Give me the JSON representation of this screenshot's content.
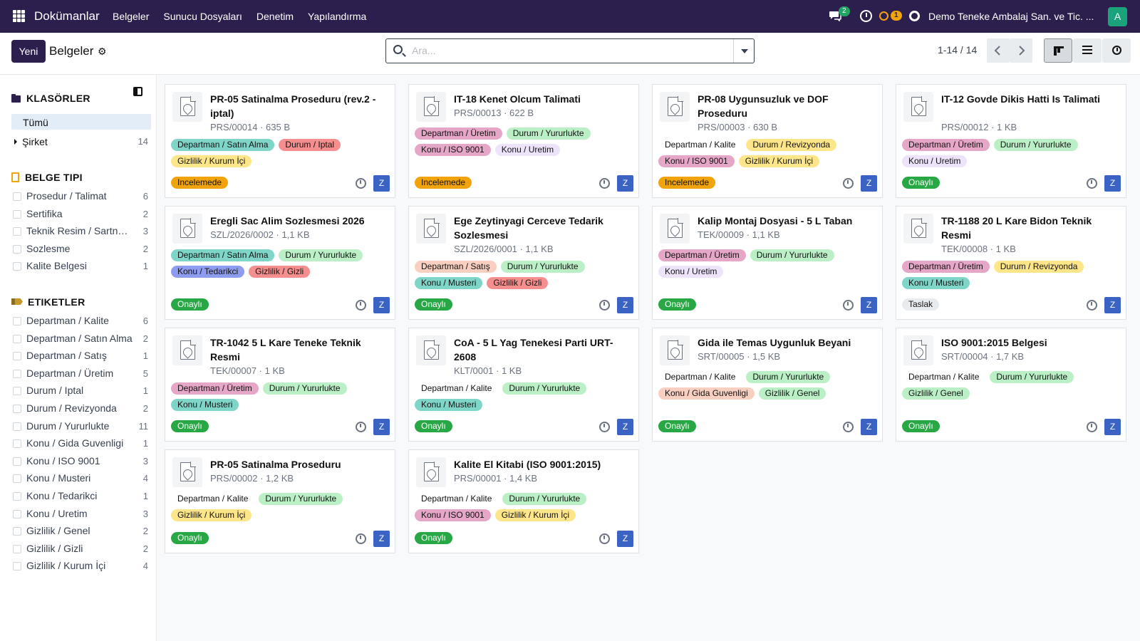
{
  "topbar": {
    "app_name": "Dokümanlar",
    "menu": [
      "Belgeler",
      "Sunucu Dosyaları",
      "Denetim",
      "Yapılandırma"
    ],
    "chat_count": "2",
    "activity_count": "1",
    "company": "Demo Teneke Ambalaj San. ve Tic. ...",
    "avatar_letter": "A",
    "bg_color": "#2c1f4e"
  },
  "control": {
    "new_label": "Yeni",
    "breadcrumb": "Belgeler",
    "search_placeholder": "Ara...",
    "pager": "1-14 / 14"
  },
  "sidebar": {
    "folders_title": "KLASÖRLER",
    "all_label": "Tümü",
    "company_folder": {
      "label": "Şirket",
      "count": "14"
    },
    "doctype_title": "BELGE TIPI",
    "doctypes": [
      {
        "label": "Prosedur / Talimat",
        "count": "6"
      },
      {
        "label": "Sertifika",
        "count": "2"
      },
      {
        "label": "Teknik Resim / Sartname",
        "count": "3"
      },
      {
        "label": "Sozlesme",
        "count": "2"
      },
      {
        "label": "Kalite Belgesi",
        "count": "1"
      }
    ],
    "tags_title": "ETIKETLER",
    "tags": [
      {
        "label": "Departman / Kalite",
        "count": "6"
      },
      {
        "label": "Departman / Satın Alma",
        "count": "2"
      },
      {
        "label": "Departman / Satış",
        "count": "1"
      },
      {
        "label": "Departman / Üretim",
        "count": "5"
      },
      {
        "label": "Durum / Iptal",
        "count": "1"
      },
      {
        "label": "Durum / Revizyonda",
        "count": "2"
      },
      {
        "label": "Durum / Yururlukte",
        "count": "11"
      },
      {
        "label": "Konu / Gida Guvenligi",
        "count": "1"
      },
      {
        "label": "Konu / ISO 9001",
        "count": "3"
      },
      {
        "label": "Konu / Musteri",
        "count": "4"
      },
      {
        "label": "Konu / Tedarikci",
        "count": "1"
      },
      {
        "label": "Konu / Uretim",
        "count": "3"
      },
      {
        "label": "Gizlilik / Genel",
        "count": "2"
      },
      {
        "label": "Gizlilik / Gizli",
        "count": "2"
      },
      {
        "label": "Gizlilik / Kurum İçi",
        "count": "4"
      }
    ]
  },
  "documents": [
    {
      "title": "PR-05 Satinalma Proseduru (rev.2 - iptal)",
      "meta": "PRS/00014 · 635 B",
      "tags": [
        {
          "t": "Departman / Satın Alma",
          "c": "#7fd6c8"
        },
        {
          "t": "Durum / Iptal",
          "c": "#f58f8f"
        },
        {
          "t": "Gizlilik / Kurum İçi",
          "c": "#fde68a"
        }
      ],
      "status": "Incelemede",
      "status_style": "orange",
      "user": "Z"
    },
    {
      "title": "IT-18 Kenet Olcum Talimati",
      "meta": "PRS/00013 · 622 B",
      "tags": [
        {
          "t": "Departman / Üretim",
          "c": "#e6a6c7"
        },
        {
          "t": "Durum / Yururlukte",
          "c": "#bbf0c7"
        },
        {
          "t": "Konu / ISO 9001",
          "c": "#e6a6c7"
        },
        {
          "t": "Konu / Uretim",
          "c": "#ede4fb"
        }
      ],
      "status": "Incelemede",
      "status_style": "orange",
      "user": "Z"
    },
    {
      "title": "PR-08 Uygunsuzluk ve DOF Proseduru",
      "meta": "PRS/00003 · 630 B",
      "tags": [
        {
          "t": "Departman / Kalite",
          "c": "#ffffff"
        },
        {
          "t": "Durum / Revizyonda",
          "c": "#fde68a"
        },
        {
          "t": "Konu / ISO 9001",
          "c": "#e6a6c7"
        },
        {
          "t": "Gizlilik / Kurum İçi",
          "c": "#fde68a"
        }
      ],
      "status": "Incelemede",
      "status_style": "orange",
      "user": "Z"
    },
    {
      "title": "IT-12 Govde Dikis Hatti Is Talimati",
      "meta": "PRS/00012 · 1 KB",
      "tags": [
        {
          "t": "Departman / Üretim",
          "c": "#e6a6c7"
        },
        {
          "t": "Durum / Yururlukte",
          "c": "#bbf0c7"
        },
        {
          "t": "Konu / Uretim",
          "c": "#ede4fb"
        }
      ],
      "status": "Onaylı",
      "status_style": "green",
      "user": "Z"
    },
    {
      "title": "Eregli Sac Alim Sozlesmesi 2026",
      "meta": "SZL/2026/0002 · 1,1 KB",
      "tags": [
        {
          "t": "Departman / Satın Alma",
          "c": "#7fd6c8"
        },
        {
          "t": "Durum / Yururlukte",
          "c": "#bbf0c7"
        },
        {
          "t": "Konu / Tedarikci",
          "c": "#8e9cf0"
        },
        {
          "t": "Gizlilik / Gizli",
          "c": "#f58f8f"
        }
      ],
      "status": "Onaylı",
      "status_style": "green",
      "user": "Z"
    },
    {
      "title": "Ege Zeytinyagi Cerceve Tedarik Sozlesmesi",
      "meta": "SZL/2026/0001 · 1,1 KB",
      "tags": [
        {
          "t": "Departman / Satış",
          "c": "#f8cfc0"
        },
        {
          "t": "Durum / Yururlukte",
          "c": "#bbf0c7"
        },
        {
          "t": "Konu / Musteri",
          "c": "#7fd6c8"
        },
        {
          "t": "Gizlilik / Gizli",
          "c": "#f58f8f"
        }
      ],
      "status": "Onaylı",
      "status_style": "green",
      "user": "Z"
    },
    {
      "title": "Kalip Montaj Dosyasi - 5 L Taban",
      "meta": "TEK/00009 · 1,1 KB",
      "tags": [
        {
          "t": "Departman / Üretim",
          "c": "#e6a6c7"
        },
        {
          "t": "Durum / Yururlukte",
          "c": "#bbf0c7"
        },
        {
          "t": "Konu / Uretim",
          "c": "#ede4fb"
        }
      ],
      "status": "Onaylı",
      "status_style": "green",
      "user": "Z"
    },
    {
      "title": "TR-1188 20 L Kare Bidon Teknik Resmi",
      "meta": "TEK/00008 · 1 KB",
      "tags": [
        {
          "t": "Departman / Üretim",
          "c": "#e6a6c7"
        },
        {
          "t": "Durum / Revizyonda",
          "c": "#fde68a"
        },
        {
          "t": "Konu / Musteri",
          "c": "#7fd6c8"
        }
      ],
      "status": "Taslak",
      "status_style": "gray",
      "user": "Z"
    },
    {
      "title": "TR-1042 5 L Kare Teneke Teknik Resmi",
      "meta": "TEK/00007 · 1 KB",
      "tags": [
        {
          "t": "Departman / Üretim",
          "c": "#e6a6c7"
        },
        {
          "t": "Durum / Yururlukte",
          "c": "#bbf0c7"
        },
        {
          "t": "Konu / Musteri",
          "c": "#7fd6c8"
        }
      ],
      "status": "Onaylı",
      "status_style": "green",
      "user": "Z"
    },
    {
      "title": "CoA - 5 L Yag Tenekesi Parti URT-2608",
      "meta": "KLT/0001 · 1 KB",
      "tags": [
        {
          "t": "Departman / Kalite",
          "c": "#ffffff"
        },
        {
          "t": "Durum / Yururlukte",
          "c": "#bbf0c7"
        },
        {
          "t": "Konu / Musteri",
          "c": "#7fd6c8"
        }
      ],
      "status": "Onaylı",
      "status_style": "green",
      "user": "Z"
    },
    {
      "title": "Gida ile Temas Uygunluk Beyani",
      "meta": "SRT/00005 · 1,5 KB",
      "tags": [
        {
          "t": "Departman / Kalite",
          "c": "#ffffff"
        },
        {
          "t": "Durum / Yururlukte",
          "c": "#bbf0c7"
        },
        {
          "t": "Konu / Gida Guvenligi",
          "c": "#f8cfc0"
        },
        {
          "t": "Gizlilik / Genel",
          "c": "#bbf0c7"
        }
      ],
      "status": "Onaylı",
      "status_style": "green",
      "user": "Z"
    },
    {
      "title": "ISO 9001:2015 Belgesi",
      "meta": "SRT/00004 · 1,7 KB",
      "tags": [
        {
          "t": "Departman / Kalite",
          "c": "#ffffff"
        },
        {
          "t": "Durum / Yururlukte",
          "c": "#bbf0c7"
        },
        {
          "t": "Gizlilik / Genel",
          "c": "#bbf0c7"
        }
      ],
      "status": "Onaylı",
      "status_style": "green",
      "user": "Z"
    },
    {
      "title": "PR-05 Satinalma Proseduru",
      "meta": "PRS/00002 · 1,2 KB",
      "tags": [
        {
          "t": "Departman / Kalite",
          "c": "#ffffff"
        },
        {
          "t": "Durum / Yururlukte",
          "c": "#bbf0c7"
        },
        {
          "t": "Gizlilik / Kurum İçi",
          "c": "#fde68a"
        }
      ],
      "status": "Onaylı",
      "status_style": "green",
      "user": "Z"
    },
    {
      "title": "Kalite El Kitabi (ISO 9001:2015)",
      "meta": "PRS/00001 · 1,4 KB",
      "tags": [
        {
          "t": "Departman / Kalite",
          "c": "#ffffff"
        },
        {
          "t": "Durum / Yururlukte",
          "c": "#bbf0c7"
        },
        {
          "t": "Konu / ISO 9001",
          "c": "#e6a6c7"
        },
        {
          "t": "Gizlilik / Kurum İçi",
          "c": "#fde68a"
        }
      ],
      "status": "Onaylı",
      "status_style": "green",
      "user": "Z"
    }
  ]
}
